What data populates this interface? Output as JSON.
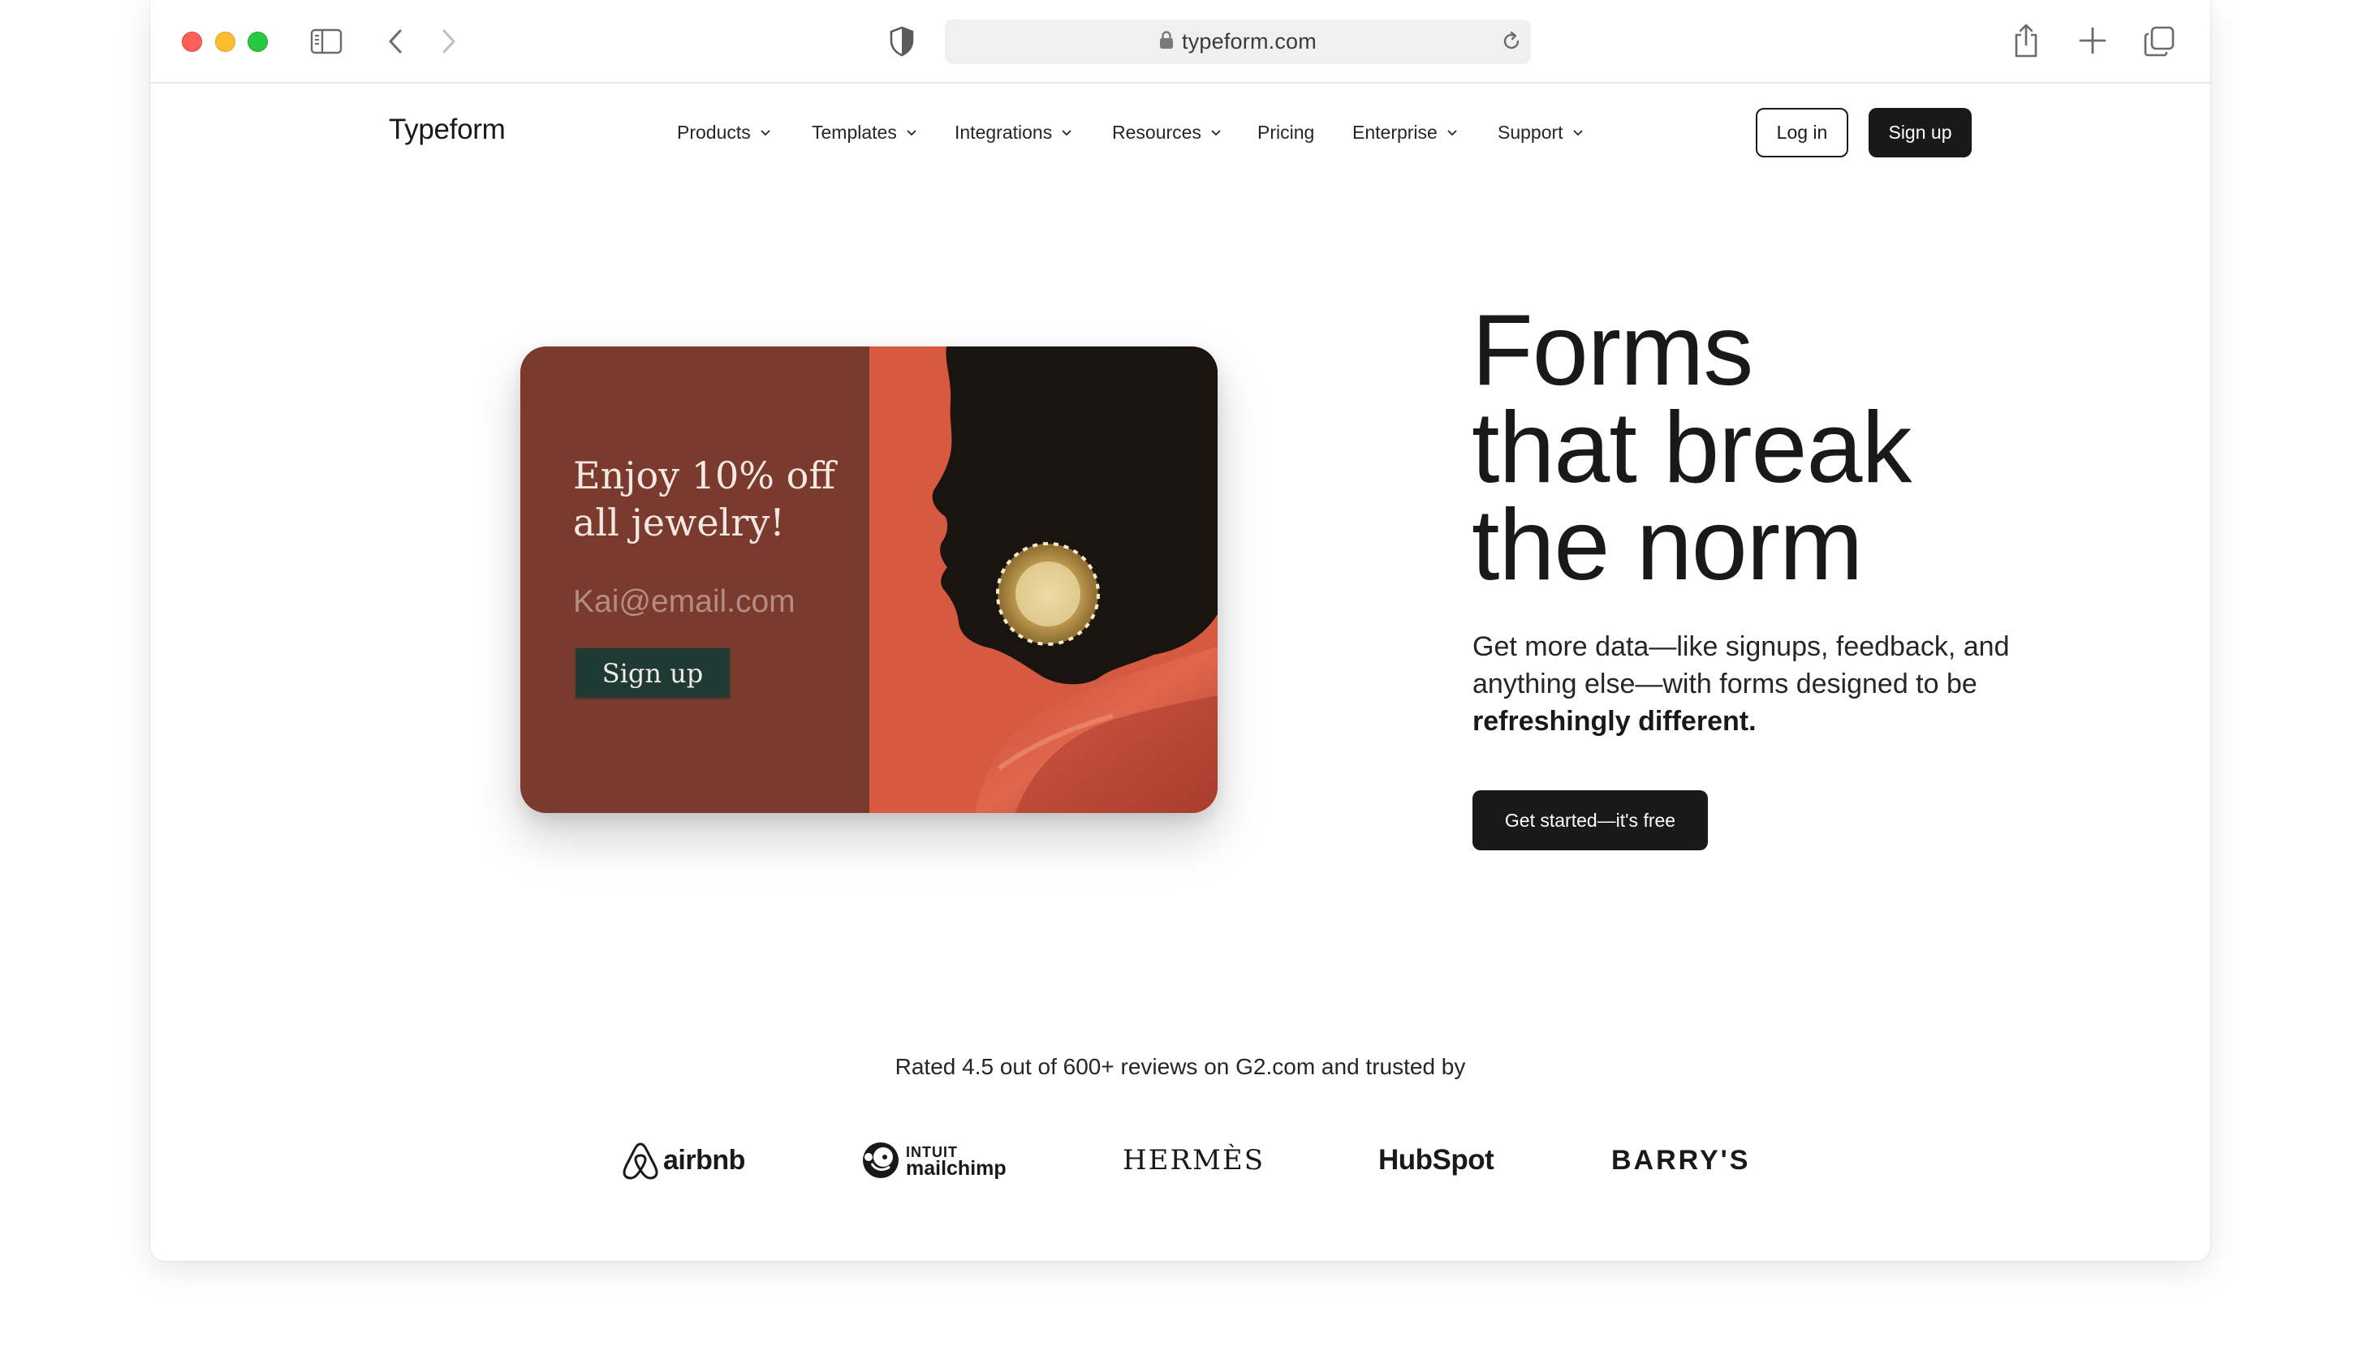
{
  "browser": {
    "url": "typeform.com",
    "colors": {
      "close": "#fe5f57",
      "minimize": "#febc2e",
      "zoom": "#28c840"
    }
  },
  "site": {
    "logo": "Typeform",
    "nav": [
      {
        "label": "Products",
        "dropdown": true
      },
      {
        "label": "Templates",
        "dropdown": true
      },
      {
        "label": "Integrations",
        "dropdown": true
      },
      {
        "label": "Resources",
        "dropdown": true
      },
      {
        "label": "Pricing",
        "dropdown": false
      },
      {
        "label": "Enterprise",
        "dropdown": true
      },
      {
        "label": "Support",
        "dropdown": true
      }
    ],
    "login_label": "Log in",
    "signup_label": "Sign up"
  },
  "hero": {
    "card": {
      "title": "Enjoy 10% off all jewelry!",
      "email_placeholder": "Kai@email.com",
      "button_label": "Sign up",
      "colors": {
        "panel": "#7a3a2e",
        "photo_bg": "#d65a40",
        "button": "#1f3a33"
      }
    },
    "headline_lines": [
      "Forms",
      "that break",
      "the norm"
    ],
    "subtext": "Get more data—like signups, feedback, and anything else—with forms designed to be",
    "subtext_bold": "refreshingly different.",
    "cta_label": "Get started—it's free"
  },
  "trust": {
    "rated_text": "Rated 4.5 out of 600+ reviews on G2.com and trusted by",
    "brands": {
      "airbnb": "airbnb",
      "mailchimp_top": "INTUIT",
      "mailchimp_bottom": "mailchimp",
      "hermes": "HERMÈS",
      "hubspot": "HubSpot",
      "barrys": "BARRY'S"
    }
  }
}
